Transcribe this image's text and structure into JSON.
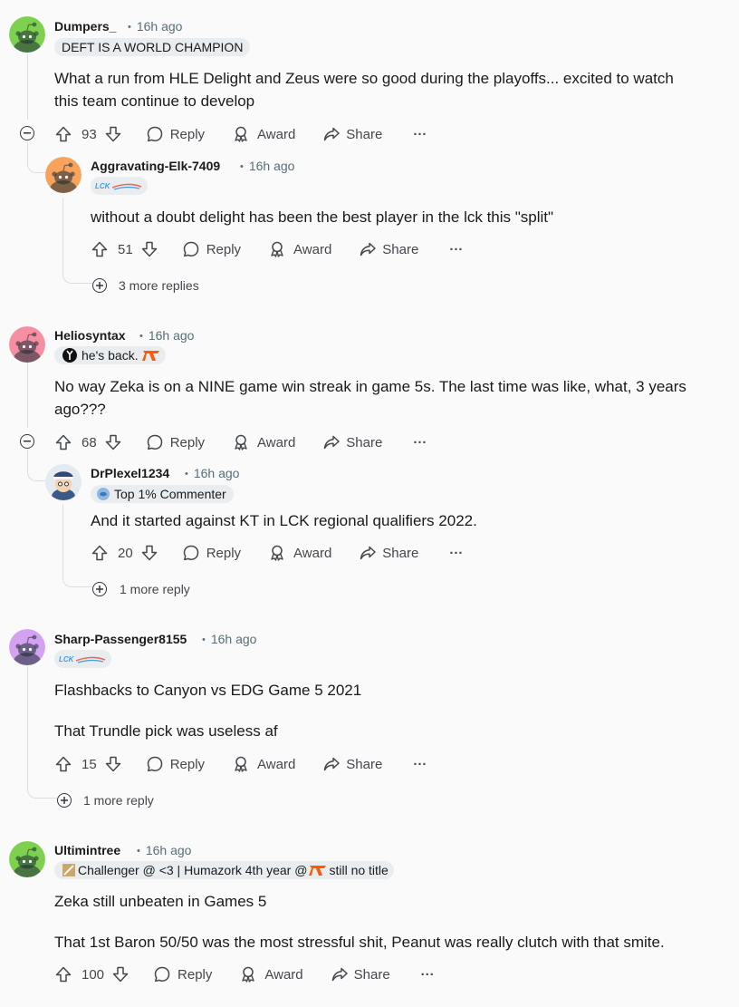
{
  "comments": [
    {
      "username": "Dumpers_",
      "time": "16h ago",
      "flair": "DEFT IS A WORLD CHAMPION",
      "body": [
        "What a run from HLE Delight and Zeus were so good during the playoffs... excited to watch",
        "this team continue to develop"
      ],
      "votes": "93",
      "avatar_color": "#7ed14e",
      "reply": {
        "username": "Aggravating-Elk-7409",
        "time": "16h ago",
        "flair_icon": "lck-logo-icon",
        "body": [
          "without a doubt delight has been the best player in the lck this \"split\""
        ],
        "votes": "51",
        "avatar_color": "#f7a35c",
        "more_replies": "3 more replies"
      }
    },
    {
      "username": "Heliosyntax",
      "time": "16h ago",
      "flair": "he's back.",
      "body": [
        "No way Zeka is on a NINE game win streak in game 5s. The last time was like, what, 3 years",
        "ago???"
      ],
      "votes": "68",
      "avatar_color": "#f78fa2",
      "reply": {
        "username": "DrPlexel1234",
        "time": "16h ago",
        "flair": "Top 1% Commenter",
        "body": [
          "And it started against KT in LCK regional qualifiers 2022."
        ],
        "votes": "20",
        "more_replies": "1 more reply"
      }
    },
    {
      "username": "Sharp-Passenger8155",
      "time": "16h ago",
      "flair_icon": "lck-logo-icon",
      "body": [
        "Flashbacks to Canyon vs EDG Game 5 2021",
        "That Trundle pick was useless af"
      ],
      "votes": "15",
      "avatar_color": "#d3a2f0",
      "more_replies": "1 more reply"
    },
    {
      "username": "Ultimintree",
      "time": "16h ago",
      "flair_parts": [
        "Challenger @ <3 | Humazork 4th year @ ",
        "still no title"
      ],
      "body": [
        "Zeka still unbeaten in Games 5",
        "That 1st Baron 50/50 was the most stressful shit, Peanut was really clutch with that smite."
      ],
      "votes": "100",
      "avatar_color": "#7ed14e"
    }
  ],
  "actions": {
    "reply": "Reply",
    "award": "Award",
    "share": "Share",
    "more": "···"
  },
  "colors": {
    "accent_fnatic": "#ff5a00",
    "thread_line": "#dcdfe2",
    "meta": "#576f76"
  }
}
